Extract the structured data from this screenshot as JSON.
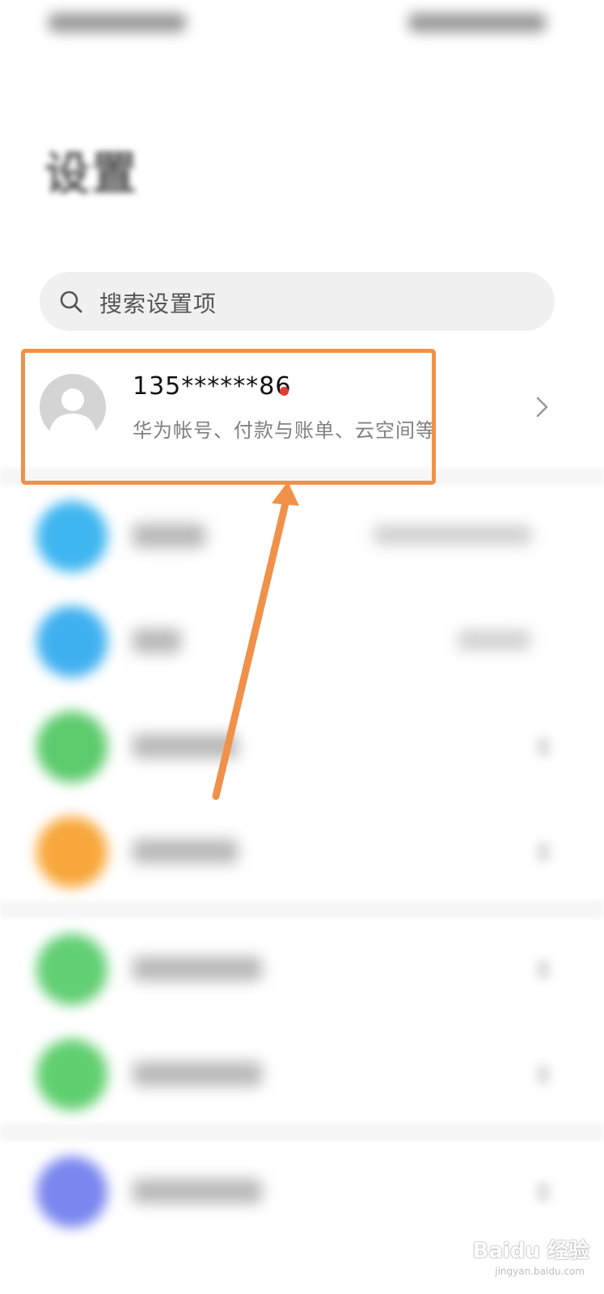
{
  "search": {
    "placeholder": "搜索设置项",
    "icon": "search-icon"
  },
  "account": {
    "name": "135******86",
    "subtitle": "华为帐号、付款与账单、云空间等",
    "avatar_icon": "user-avatar-icon",
    "notification_color": "#e63b2e",
    "chevron_icon": "chevron-right-icon"
  },
  "annotation": {
    "color": "#f0914a"
  },
  "settings_rows": [
    {
      "icon_color": "#3fb6f0"
    },
    {
      "icon_color": "#3fb0ef"
    },
    {
      "icon_color": "#5ccb6c"
    },
    {
      "icon_color": "#f8a73b"
    },
    {
      "icon_color": "#61cf73"
    },
    {
      "icon_color": "#5fcf6f"
    },
    {
      "icon_color": "#7b86ef"
    }
  ],
  "watermark": {
    "logo": "Baidu 经验",
    "url": "jingyan.baidu.com"
  }
}
